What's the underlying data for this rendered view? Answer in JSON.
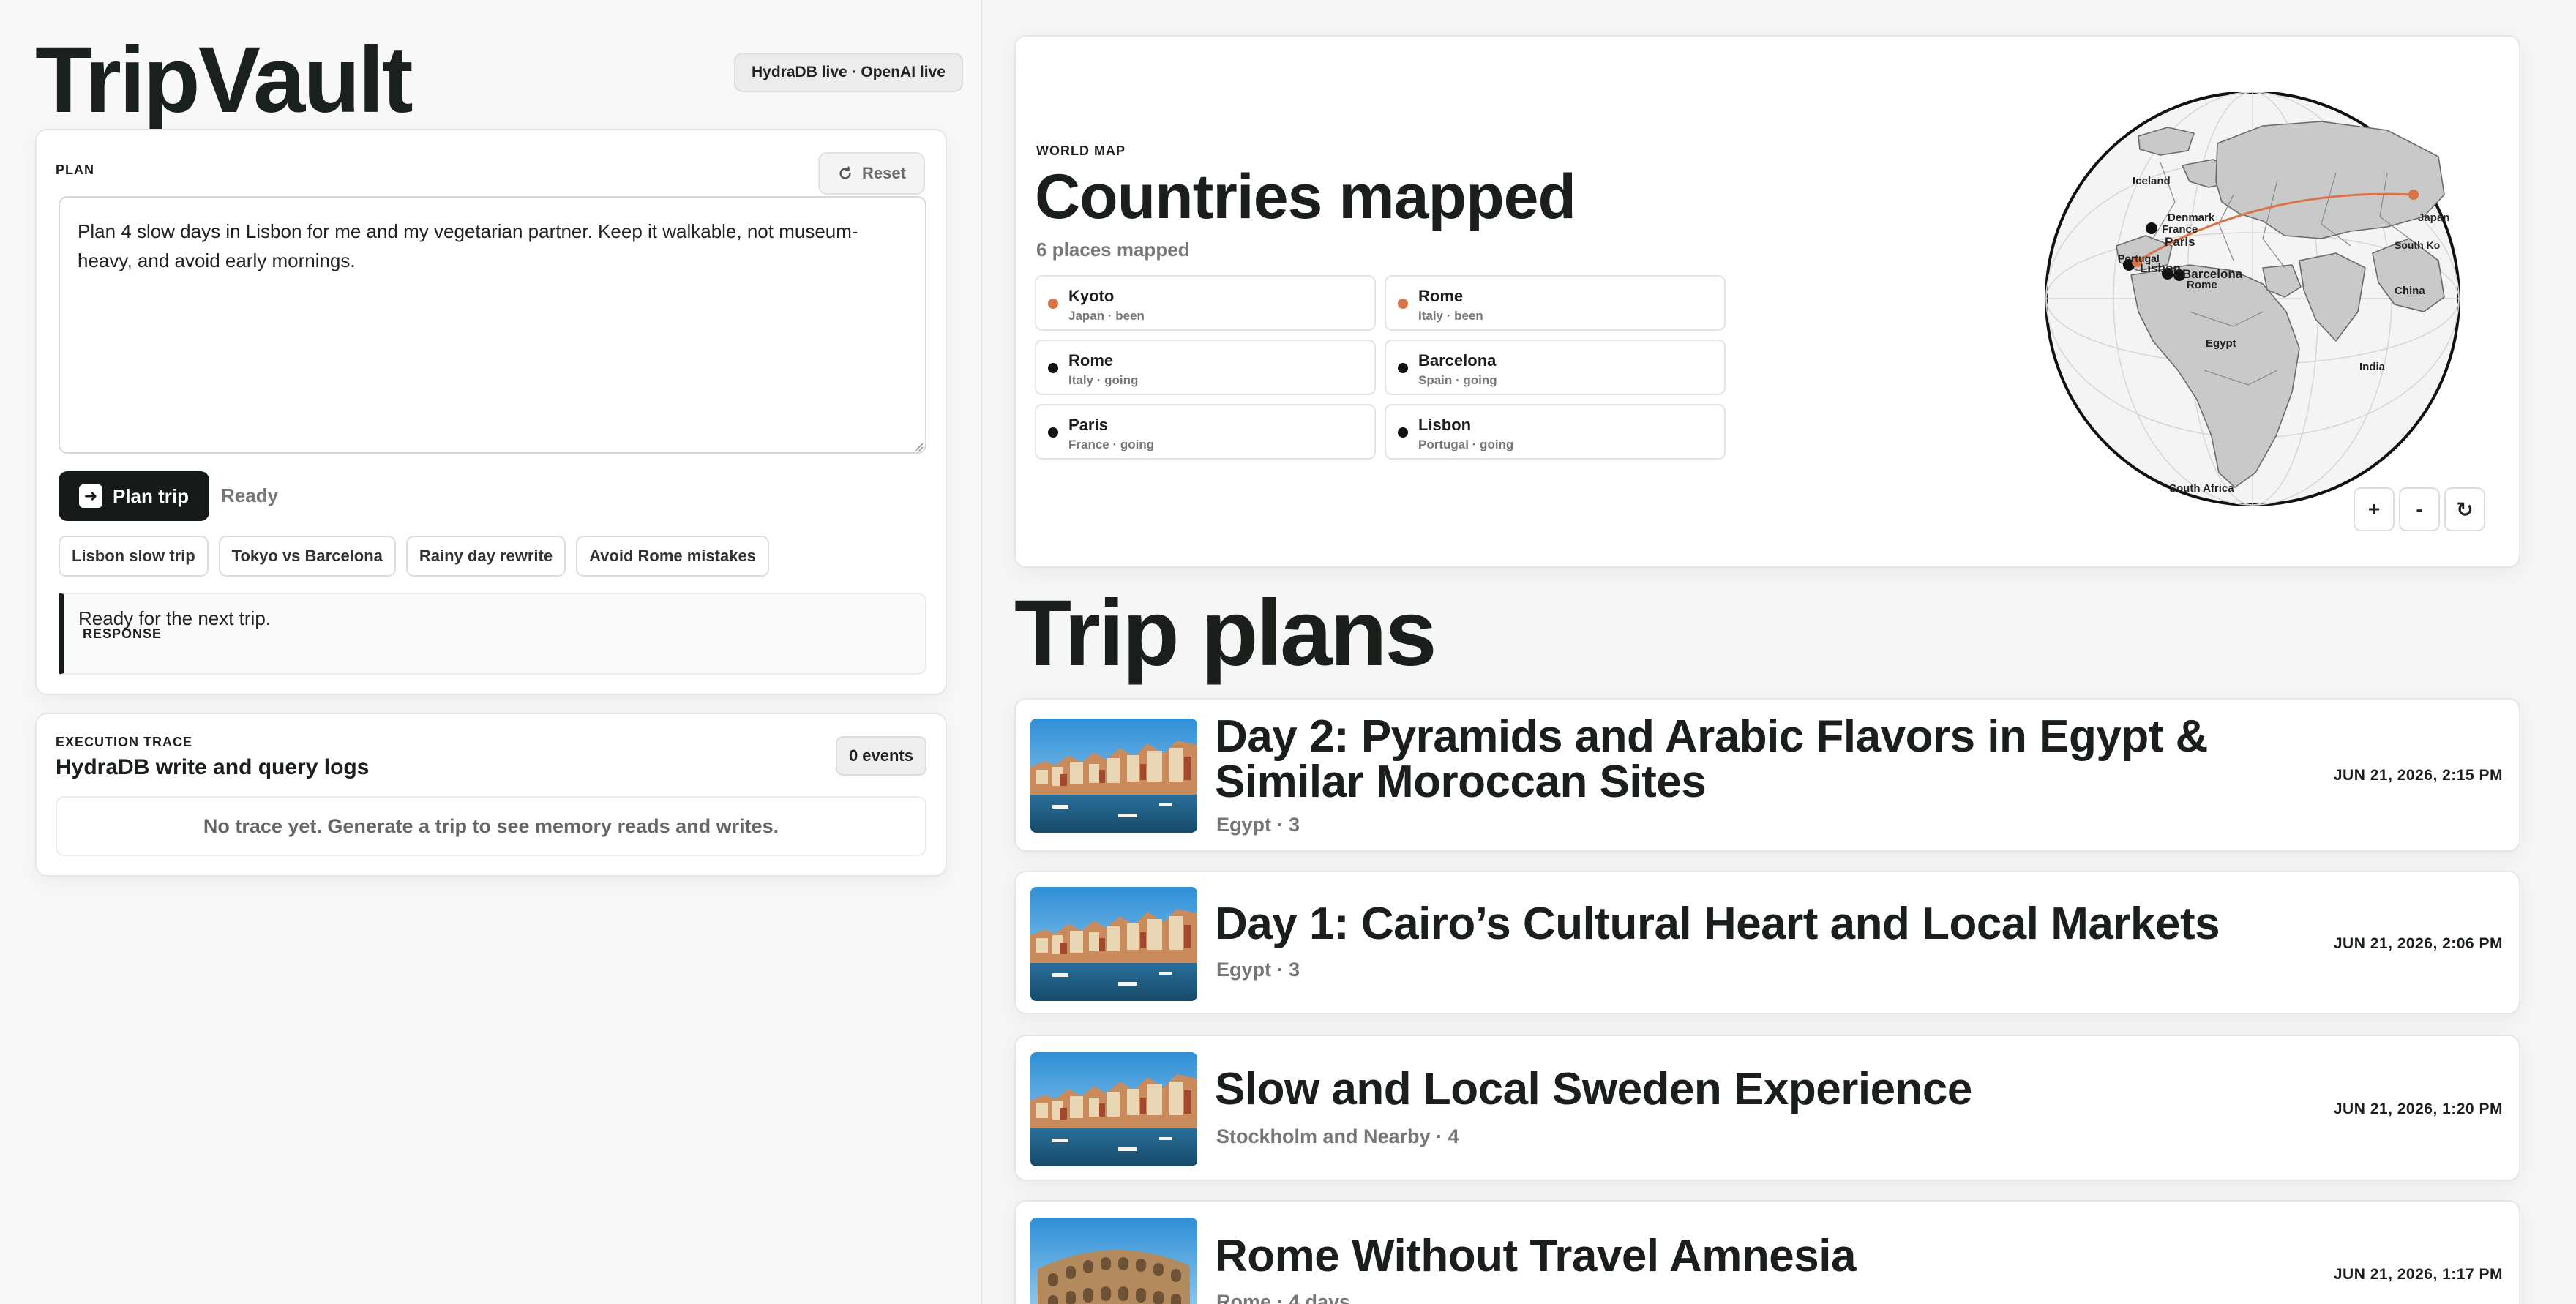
{
  "app": {
    "title": "TripVault",
    "status": "HydraDB live · OpenAI live"
  },
  "plan": {
    "label": "PLAN",
    "reset_label": "Reset",
    "prompt": "Plan 4 slow days in Lisbon for me and my vegetarian partner. Keep it walkable, not museum-heavy, and avoid early mornings.",
    "button_label": "Plan trip",
    "status": "Ready",
    "suggestions": [
      "Lisbon slow trip",
      "Tokyo vs Barcelona",
      "Rainy day rewrite",
      "Avoid Rome mistakes"
    ],
    "response_label": "RESPONSE",
    "response_text": "Ready for the next trip."
  },
  "trace": {
    "label": "EXECUTION TRACE",
    "title": "HydraDB write and query logs",
    "events": "0 events",
    "empty": "No trace yet. Generate a trip to see memory reads and writes."
  },
  "world_map": {
    "label": "WORLD MAP",
    "title": "Countries mapped",
    "count": "6 places mapped",
    "colors": {
      "been": "#d9734a",
      "going": "#111111"
    },
    "places": [
      {
        "name": "Kyoto",
        "sub": "Japan · been",
        "status": "been"
      },
      {
        "name": "Rome",
        "sub": "Italy · been",
        "status": "been"
      },
      {
        "name": "Rome",
        "sub": "Italy · going",
        "status": "going"
      },
      {
        "name": "Barcelona",
        "sub": "Spain · going",
        "status": "going"
      },
      {
        "name": "Paris",
        "sub": "France · going",
        "status": "going"
      },
      {
        "name": "Lisbon",
        "sub": "Portugal · going",
        "status": "going"
      }
    ],
    "globe_labels": {
      "iceland": "Iceland",
      "denmark": "Denmark",
      "france": "France",
      "paris": "Paris",
      "portugal": "Portugal",
      "lisbon": "Lisbon",
      "barcelona": "Barcelona",
      "rome": "Rome",
      "egypt": "Egypt",
      "india": "India",
      "china": "China",
      "japan": "Japan",
      "south_korea": "South Ko",
      "south_africa": "South Africa"
    },
    "controls": {
      "zoom_in": "+",
      "zoom_out": "-",
      "reset_icon": "↻"
    }
  },
  "trips": {
    "heading": "Trip plans",
    "items": [
      {
        "title": "Day 2: Pyramids and Arabic Flavors in Egypt & Similar Moroccan Sites",
        "sub": "Egypt · 3",
        "date": "JUN 21, 2026, 2:15 PM",
        "image": "coastal-town-photo"
      },
      {
        "title": "Day 1: Cairo’s Cultural Heart and Local Markets",
        "sub": "Egypt · 3",
        "date": "JUN 21, 2026, 2:06 PM",
        "image": "coastal-town-photo"
      },
      {
        "title": "Slow and Local Sweden Experience",
        "sub": "Stockholm and Nearby · 4",
        "date": "JUN 21, 2026, 1:20 PM",
        "image": "coastal-town-photo"
      },
      {
        "title": "Rome Without Travel Amnesia",
        "sub": "Rome · 4 days",
        "date": "JUN 21, 2026, 1:17 PM",
        "image": "colosseum-photo"
      }
    ]
  }
}
